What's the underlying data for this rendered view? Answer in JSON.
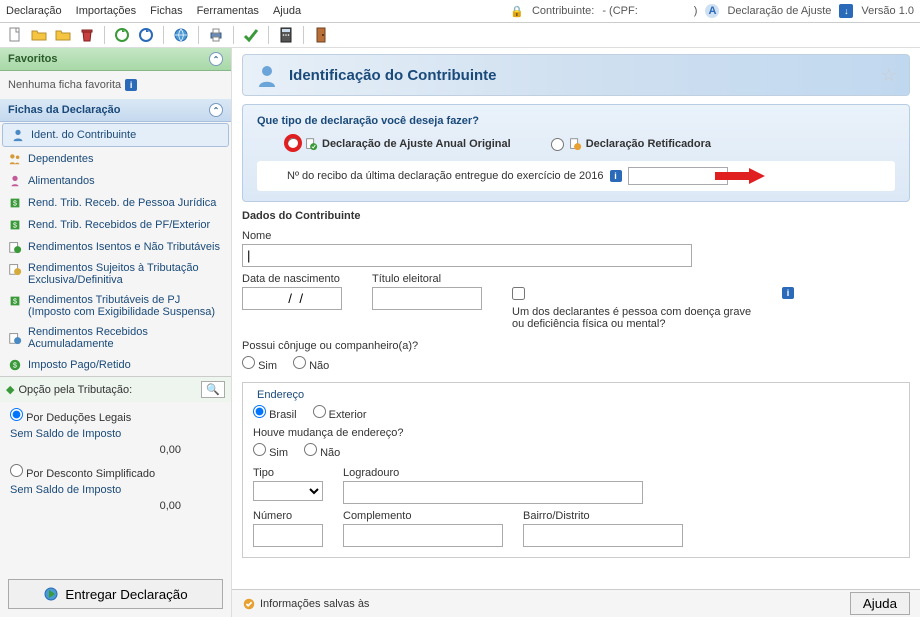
{
  "menu": {
    "items": [
      "Declaração",
      "Importações",
      "Fichas",
      "Ferramentas",
      "Ajuda"
    ]
  },
  "topbar": {
    "contribuinte_label": "Contribuinte:",
    "cpf_label": "- (CPF:",
    "cpf_close": ")",
    "decl_ajuste": "Declaração de Ajuste",
    "versao": "Versão 1.0"
  },
  "sidebar": {
    "favoritos": {
      "title": "Favoritos",
      "empty": "Nenhuma ficha favorita"
    },
    "fichas": {
      "title": "Fichas da Declaração",
      "items": [
        "Ident. do Contribuinte",
        "Dependentes",
        "Alimentandos",
        "Rend. Trib. Receb. de Pessoa Jurídica",
        "Rend. Trib. Recebidos de PF/Exterior",
        "Rendimentos Isentos e Não Tributáveis",
        "Rendimentos Sujeitos à Tributação Exclusiva/Definitiva",
        "Rendimentos Tributáveis de PJ (Imposto com Exigibilidade Suspensa)",
        "Rendimentos Recebidos Acumuladamente",
        "Imposto Pago/Retido"
      ]
    },
    "trib": {
      "title": "Opção pela Tributação:",
      "opt1": "Por Deduções Legais",
      "sem_saldo": "Sem Saldo de Imposto",
      "val": "0,00",
      "opt2": "Por Desconto Simplificado"
    },
    "submit": "Entregar Declaração"
  },
  "page": {
    "title": "Identificação do Contribuinte",
    "question": "Que tipo de declaração você deseja fazer?",
    "opt_original": "Declaração de Ajuste Anual Original",
    "opt_retif": "Declaração Retificadora",
    "recibo_label": "Nº do recibo da última declaração entregue do exercício de 2016",
    "dados_title": "Dados do Contribuinte",
    "nome_label": "Nome",
    "dn_label": "Data de nascimento",
    "dn_value": "  /  /",
    "titulo_label": "Título eleitoral",
    "doenca_label": "Um dos declarantes é pessoa com doença grave ou deficiência física ou mental?",
    "conjuge_label": "Possui cônjuge ou companheiro(a)?",
    "sim": "Sim",
    "nao": "Não",
    "endereco": "Endereço",
    "brasil": "Brasil",
    "exterior": "Exterior",
    "mudanca": "Houve mudança de endereço?",
    "tipo": "Tipo",
    "logradouro": "Logradouro",
    "numero": "Número",
    "complemento": "Complemento",
    "bairro": "Bairro/Distrito"
  },
  "footer": {
    "saved": "Informações salvas às",
    "ajuda": "Ajuda"
  }
}
